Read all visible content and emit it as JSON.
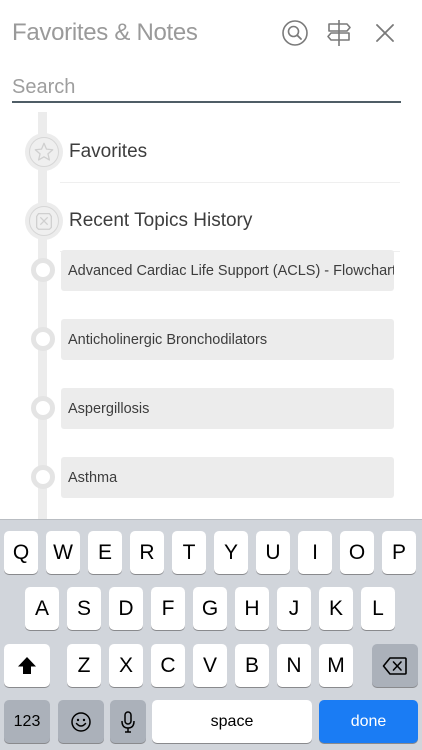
{
  "header": {
    "title": "Favorites & Notes"
  },
  "search": {
    "placeholder": "Search",
    "value": ""
  },
  "sections": {
    "favorites": {
      "label": "Favorites"
    },
    "history": {
      "label": "Recent Topics History"
    }
  },
  "topics": [
    {
      "label": "Advanced Cardiac Life Support (ACLS) - Flowchart"
    },
    {
      "label": "Anticholinergic Bronchodilators"
    },
    {
      "label": "Aspergillosis"
    },
    {
      "label": "Asthma"
    }
  ],
  "keyboard": {
    "row1": [
      "Q",
      "W",
      "E",
      "R",
      "T",
      "Y",
      "U",
      "I",
      "O",
      "P"
    ],
    "row2": [
      "A",
      "S",
      "D",
      "F",
      "G",
      "H",
      "J",
      "K",
      "L"
    ],
    "row3": [
      "Z",
      "X",
      "C",
      "V",
      "B",
      "N",
      "M"
    ],
    "numbers_label": "123",
    "space_label": "space",
    "done_label": "done"
  },
  "colors": {
    "accent": "#1a7cf4",
    "keyboard_bg": "#d1d5db",
    "topic_bg": "#ececec",
    "search_underline": "#4f5d66"
  },
  "icons": {
    "search": "search-icon",
    "signpost": "signpost-icon",
    "close": "close-icon",
    "favorites": "star-icon",
    "history": "history-icon",
    "shift": "shift-icon",
    "backspace": "backspace-icon",
    "emoji": "emoji-icon",
    "mic": "microphone-icon"
  }
}
